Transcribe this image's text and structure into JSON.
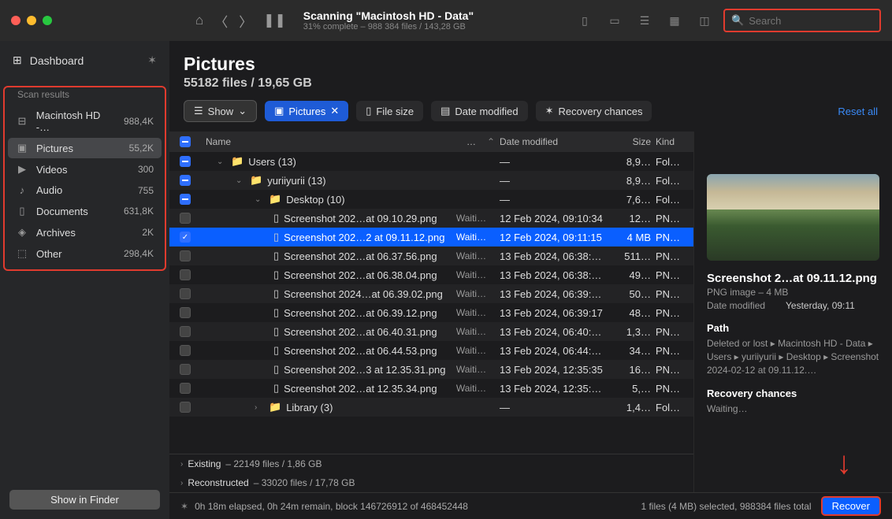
{
  "titlebar": {
    "title": "Scanning \"Macintosh HD - Data\"",
    "subtitle": "31% complete – 988 384 files / 143,28 GB",
    "search_placeholder": "Search"
  },
  "sidebar": {
    "dashboard": "Dashboard",
    "section_label": "Scan results",
    "items": [
      {
        "icon": "drive",
        "label": "Macintosh HD -…",
        "count": "988,4K"
      },
      {
        "icon": "image",
        "label": "Pictures",
        "count": "55,2K",
        "active": true
      },
      {
        "icon": "video",
        "label": "Videos",
        "count": "300"
      },
      {
        "icon": "audio",
        "label": "Audio",
        "count": "755"
      },
      {
        "icon": "doc",
        "label": "Documents",
        "count": "631,8K"
      },
      {
        "icon": "archive",
        "label": "Archives",
        "count": "2K"
      },
      {
        "icon": "other",
        "label": "Other",
        "count": "298,4K"
      }
    ],
    "show_in_finder": "Show in Finder"
  },
  "page": {
    "title": "Pictures",
    "subtitle": "55182 files / 19,65 GB"
  },
  "filters": {
    "show": "Show",
    "pictures": "Pictures",
    "file_size": "File size",
    "date_modified": "Date modified",
    "recovery": "Recovery chances",
    "reset": "Reset all"
  },
  "columns": {
    "name": "Name",
    "more": "…",
    "date": "Date modified",
    "size": "Size",
    "kind": "Kind"
  },
  "rows": [
    {
      "check": "blue",
      "indent": 1,
      "chev": "down",
      "icon": "folder",
      "name": "Users (13)",
      "more": "",
      "date": "—",
      "size": "8,9…",
      "kind": "Fol…"
    },
    {
      "check": "blue",
      "indent": 2,
      "chev": "down",
      "icon": "folder",
      "name": "yuriiyurii (13)",
      "more": "",
      "date": "—",
      "size": "8,9…",
      "kind": "Fol…"
    },
    {
      "check": "blue",
      "indent": 3,
      "chev": "down",
      "icon": "folder",
      "name": "Desktop (10)",
      "more": "",
      "date": "—",
      "size": "7,6…",
      "kind": "Fol…"
    },
    {
      "check": "grey",
      "indent": 5,
      "icon": "file",
      "name": "Screenshot 202…at 09.10.29.png",
      "more": "Waiti…",
      "date": "12 Feb 2024, 09:10:34",
      "size": "12…",
      "kind": "PN…"
    },
    {
      "check": "checked",
      "indent": 5,
      "icon": "file",
      "name": "Screenshot 202…2 at 09.11.12.png",
      "more": "Waiti…",
      "date": "12 Feb 2024, 09:11:15",
      "size": "4 MB",
      "kind": "PN…",
      "selected": true
    },
    {
      "check": "grey",
      "indent": 5,
      "icon": "file",
      "name": "Screenshot 202…at 06.37.56.png",
      "more": "Waiti…",
      "date": "13 Feb 2024, 06:38:…",
      "size": "511…",
      "kind": "PN…"
    },
    {
      "check": "grey",
      "indent": 5,
      "icon": "file",
      "name": "Screenshot 202…at 06.38.04.png",
      "more": "Waiti…",
      "date": "13 Feb 2024, 06:38:…",
      "size": "49…",
      "kind": "PN…"
    },
    {
      "check": "grey",
      "indent": 5,
      "icon": "file",
      "name": "Screenshot 2024…at 06.39.02.png",
      "more": "Waiti…",
      "date": "13 Feb 2024, 06:39:…",
      "size": "50…",
      "kind": "PN…"
    },
    {
      "check": "grey",
      "indent": 5,
      "icon": "file",
      "name": "Screenshot 202…at 06.39.12.png",
      "more": "Waiti…",
      "date": "13 Feb 2024, 06:39:17",
      "size": "48…",
      "kind": "PN…"
    },
    {
      "check": "grey",
      "indent": 5,
      "icon": "file",
      "name": "Screenshot 202…at 06.40.31.png",
      "more": "Waiti…",
      "date": "13 Feb 2024, 06:40:…",
      "size": "1,3…",
      "kind": "PN…"
    },
    {
      "check": "grey",
      "indent": 5,
      "icon": "file",
      "name": "Screenshot 202…at 06.44.53.png",
      "more": "Waiti…",
      "date": "13 Feb 2024, 06:44:…",
      "size": "34…",
      "kind": "PN…"
    },
    {
      "check": "grey",
      "indent": 5,
      "icon": "file",
      "name": "Screenshot 202…3 at 12.35.31.png",
      "more": "Waiti…",
      "date": "13 Feb 2024, 12:35:35",
      "size": "16…",
      "kind": "PN…"
    },
    {
      "check": "grey",
      "indent": 5,
      "icon": "file",
      "name": "Screenshot 202…at 12.35.34.png",
      "more": "Waiti…",
      "date": "13 Feb 2024, 12:35:…",
      "size": "5,…",
      "kind": "PN…"
    },
    {
      "check": "grey",
      "indent": 3,
      "chev": "right",
      "icon": "folder",
      "name": "Library (3)",
      "more": "",
      "date": "—",
      "size": "1,4…",
      "kind": "Fol…"
    }
  ],
  "summary": {
    "existing_label": "Existing",
    "existing_val": "– 22149 files / 1,86 GB",
    "reconstructed_label": "Reconstructed",
    "reconstructed_val": "– 33020 files / 17,78 GB"
  },
  "preview": {
    "name": "Screenshot 2…at 09.11.12.png",
    "type": "PNG image – 4 MB",
    "date_lbl": "Date modified",
    "date_val": "Yesterday, 09:11",
    "path_h": "Path",
    "path": "Deleted or lost ▸ Macintosh HD - Data ▸ Users ▸ yuriiyurii ▸ Desktop ▸ Screenshot 2024-02-12 at 09.11.12.…",
    "chances_h": "Recovery chances",
    "chances": "Waiting…"
  },
  "status": {
    "progress": "0h 18m elapsed, 0h 24m remain, block 146726912 of 468452448",
    "selection": "1 files (4 MB) selected, 988384 files total",
    "recover": "Recover"
  }
}
